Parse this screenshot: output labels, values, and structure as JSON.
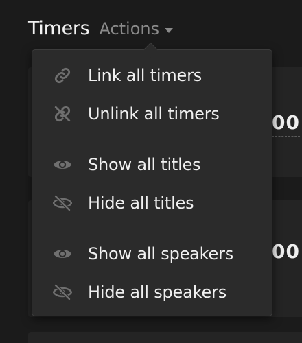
{
  "header": {
    "title": "Timers",
    "actions_label": "Actions"
  },
  "background": {
    "card_1_value": "00",
    "card_2_value": "00"
  },
  "menu": {
    "groups": [
      {
        "items": [
          {
            "label": "Link all timers",
            "icon": "link-icon"
          },
          {
            "label": "Unlink all timers",
            "icon": "unlink-icon"
          }
        ]
      },
      {
        "items": [
          {
            "label": "Show all titles",
            "icon": "eye-icon"
          },
          {
            "label": "Hide all titles",
            "icon": "eye-off-icon"
          }
        ]
      },
      {
        "items": [
          {
            "label": "Show all speakers",
            "icon": "eye-icon"
          },
          {
            "label": "Hide all speakers",
            "icon": "eye-off-icon"
          }
        ]
      }
    ]
  },
  "colors": {
    "background": "#1b1b1b",
    "menu_background": "#2b2b2b",
    "icon": "#6f6f6f",
    "text": "#f0f0f0",
    "muted": "#8a8a8a"
  }
}
